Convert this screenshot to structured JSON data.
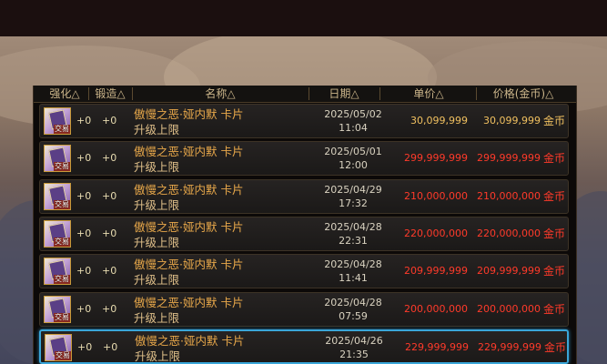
{
  "colors": {
    "normal_price": "#f0c060",
    "high_price": "#ff3a2a",
    "selected_border": "#3aa6d8"
  },
  "table": {
    "headers": {
      "strengthen": "强化△",
      "forge": "锻造△",
      "name": "名称△",
      "date": "日期△",
      "unit_price": "单价△",
      "price": "价格(金币)△"
    },
    "rows": [
      {
        "icon": "card-item-icon",
        "badge": "交易",
        "strengthen": "+0",
        "forge": "+0",
        "name_line1": "傲慢之恶·娅内默  卡片",
        "name_line2": "升级上限",
        "date": "2025/05/02",
        "time": "11:04",
        "unit_price": "30,099,999",
        "price": "30,099,999",
        "currency": "金币",
        "tone": "normal",
        "selected": false
      },
      {
        "icon": "card-item-icon",
        "badge": "交易",
        "strengthen": "+0",
        "forge": "+0",
        "name_line1": "傲慢之恶·娅内默  卡片",
        "name_line2": "升级上限",
        "date": "2025/05/01",
        "time": "12:00",
        "unit_price": "299,999,999",
        "price": "299,999,999",
        "currency": "金币",
        "tone": "high",
        "selected": false
      },
      {
        "icon": "card-item-icon",
        "badge": "交易",
        "strengthen": "+0",
        "forge": "+0",
        "name_line1": "傲慢之恶·娅内默  卡片",
        "name_line2": "升级上限",
        "date": "2025/04/29",
        "time": "17:32",
        "unit_price": "210,000,000",
        "price": "210,000,000",
        "currency": "金币",
        "tone": "high",
        "selected": false
      },
      {
        "icon": "card-item-icon",
        "badge": "交易",
        "strengthen": "+0",
        "forge": "+0",
        "name_line1": "傲慢之恶·娅内默  卡片",
        "name_line2": "升级上限",
        "date": "2025/04/28",
        "time": "22:31",
        "unit_price": "220,000,000",
        "price": "220,000,000",
        "currency": "金币",
        "tone": "high",
        "selected": false
      },
      {
        "icon": "card-item-icon",
        "badge": "交易",
        "strengthen": "+0",
        "forge": "+0",
        "name_line1": "傲慢之恶·娅内默  卡片",
        "name_line2": "升级上限",
        "date": "2025/04/28",
        "time": "11:41",
        "unit_price": "209,999,999",
        "price": "209,999,999",
        "currency": "金币",
        "tone": "high",
        "selected": false
      },
      {
        "icon": "card-item-icon",
        "badge": "交易",
        "strengthen": "+0",
        "forge": "+0",
        "name_line1": "傲慢之恶·娅内默  卡片",
        "name_line2": "升级上限",
        "date": "2025/04/28",
        "time": "07:59",
        "unit_price": "200,000,000",
        "price": "200,000,000",
        "currency": "金币",
        "tone": "high",
        "selected": false
      },
      {
        "icon": "card-item-icon",
        "badge": "交易",
        "strengthen": "+0",
        "forge": "+0",
        "name_line1": "傲慢之恶·娅内默  卡片",
        "name_line2": "升级上限",
        "date": "2025/04/26",
        "time": "21:35",
        "unit_price": "229,999,999",
        "price": "229,999,999",
        "currency": "金币",
        "tone": "high",
        "selected": true
      }
    ]
  }
}
